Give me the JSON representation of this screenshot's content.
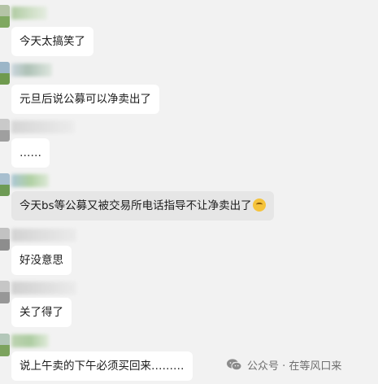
{
  "messages": [
    {
      "text": "今天太搞笑了",
      "has_emoji": false
    },
    {
      "text": "元旦后说公募可以净卖出了",
      "has_emoji": false
    },
    {
      "text": "……",
      "has_emoji": false
    },
    {
      "text": "今天bs等公募又被交易所电话指导不让净卖出了",
      "has_emoji": true,
      "emoji": "thinking-emoji"
    },
    {
      "text": "好没意思",
      "has_emoji": false
    },
    {
      "text": "关了得了",
      "has_emoji": false
    },
    {
      "text": "说上午卖的下午必须买回来………",
      "has_emoji": false
    }
  ],
  "watermark": {
    "text": "公众号 · 在等风口来",
    "icon": "wechat-official-account-icon"
  },
  "colors": {
    "background": "#f2f2f2",
    "bubble": "#ffffff",
    "bubble_highlighted": "#e6e6e6",
    "text": "#1b1b1b",
    "watermark_text": "#6e6e6e"
  }
}
